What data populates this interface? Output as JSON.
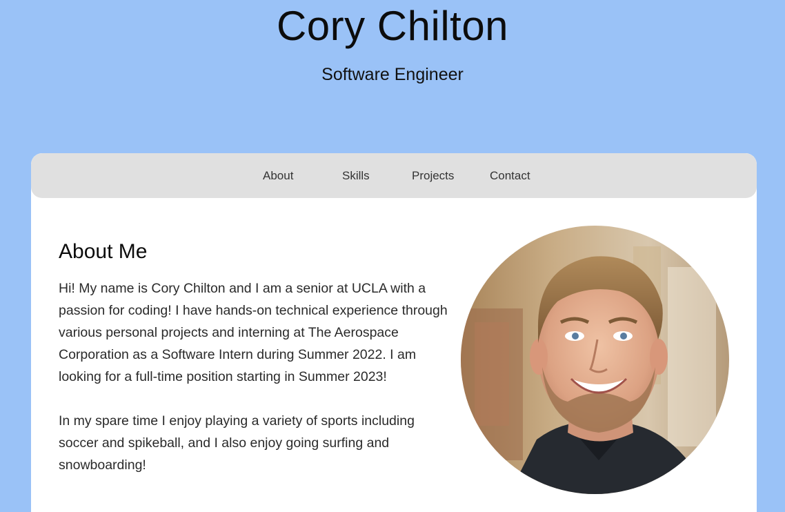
{
  "header": {
    "name": "Cory Chilton",
    "role": "Software Engineer"
  },
  "nav": {
    "items": [
      {
        "label": "About"
      },
      {
        "label": "Skills"
      },
      {
        "label": "Projects"
      },
      {
        "label": "Contact"
      }
    ]
  },
  "about": {
    "title": "About Me",
    "paragraphs": [
      "Hi! My name is Cory Chilton and I am a senior at UCLA with a passion for coding! I have hands-on technical experience through various personal projects and interning at The Aerospace Corporation as a Software Intern during Summer 2022. I am looking for a full-time position starting in Summer 2023!",
      "In my spare time I enjoy playing a variety of sports including soccer and spikeball, and I also enjoy going surfing and snowboarding!"
    ]
  },
  "colors": {
    "page_background": "#9ac2f7",
    "nav_background": "#e0e0e0",
    "card_background": "#ffffff"
  }
}
